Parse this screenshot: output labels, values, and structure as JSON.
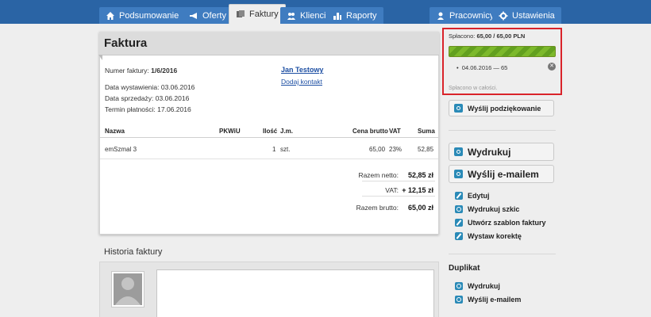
{
  "nav": {
    "tabs": [
      {
        "label": "Podsumowanie",
        "icon": "home-icon"
      },
      {
        "label": "Oferty",
        "icon": "megaphone-icon"
      },
      {
        "label": "Faktury",
        "icon": "documents-icon",
        "active": true
      },
      {
        "label": "Klienci",
        "icon": "users-icon"
      },
      {
        "label": "Raporty",
        "icon": "chart-icon"
      },
      {
        "label": "Pracownicy",
        "icon": "user-icon"
      },
      {
        "label": "Ustawienia",
        "icon": "gear-icon"
      }
    ]
  },
  "invoice": {
    "title": "Faktura",
    "number_label": "Numer faktury:",
    "number": "1/6/2016",
    "issue_date": "Data wystawienia: 03.06.2016",
    "sale_date": "Data sprzedaży: 03.06.2016",
    "due_date": "Termin płatności: 17.06.2016",
    "client_name": "Jan Testowy",
    "add_contact": "Dodaj kontakt",
    "columns": [
      "Nazwa",
      "PKWiU",
      "Ilość",
      "J.m.",
      "Cena brutto",
      "VAT",
      "Suma"
    ],
    "rows": [
      {
        "name": "emSzmal 3",
        "pkwiu": "",
        "qty": "1",
        "unit": "szt.",
        "price": "65,00",
        "vat": "23%",
        "sum": "52,85"
      }
    ],
    "totals": {
      "net_label": "Razem netto:",
      "net": "52,85 zł",
      "vat_label": "VAT:",
      "vat": "+ 12,15 zł",
      "gross_label": "Razem brutto:",
      "gross": "65,00 zł"
    }
  },
  "history": {
    "title": "Historia faktury"
  },
  "payment": {
    "summary_label": "Spłacono:",
    "summary": "65,00 / 65,00 PLN",
    "progress": 1.0,
    "item": "04.06.2016 — 65",
    "note": "Spłacono w całości."
  },
  "actions": {
    "thanks": "Wyślij podziękowanie",
    "print": "Wydrukuj",
    "email": "Wyślij e-mailem",
    "edit": "Edytuj",
    "print_draft": "Wydrukuj szkic",
    "template": "Utwórz szablon faktury",
    "correction": "Wystaw korektę"
  },
  "duplicate": {
    "title": "Duplikat",
    "print": "Wydrukuj",
    "email": "Wyślij e-mailem"
  },
  "colors": {
    "nav": "#2a64a5",
    "tab": "#3f7cc0",
    "accent": "#2a8ab7",
    "progress": "#7cb92b",
    "highlight": "#d9232a"
  }
}
